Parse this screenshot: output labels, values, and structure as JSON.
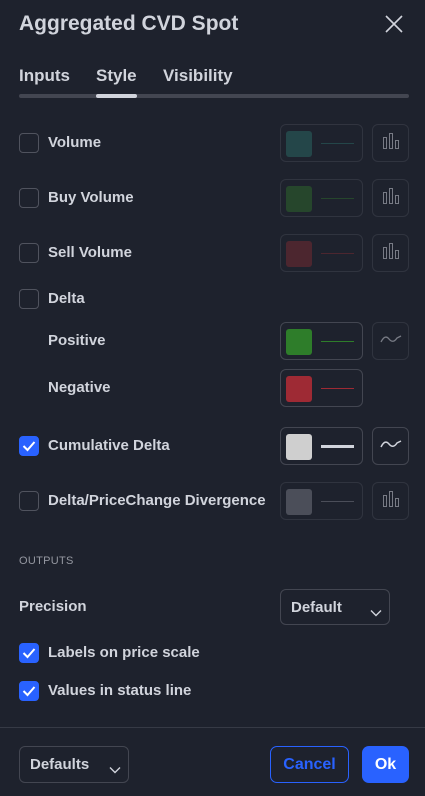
{
  "dialog": {
    "title": "Aggregated CVD Spot",
    "close_icon": "close-icon"
  },
  "tabs": [
    {
      "label": "Inputs",
      "active": false
    },
    {
      "label": "Style",
      "active": true
    },
    {
      "label": "Visibility",
      "active": false
    }
  ],
  "style_rows": [
    {
      "label": "Volume",
      "checked": false,
      "color": "#2a6b66",
      "line_color": "#2a6b66",
      "plot_icon": "histogram-icon",
      "disabled": true
    },
    {
      "label": "Buy Volume",
      "checked": false,
      "color": "#2f6b2c",
      "line_color": "#2f6b2c",
      "plot_icon": "histogram-icon",
      "disabled": true
    },
    {
      "label": "Sell Volume",
      "checked": false,
      "color": "#7a2b32",
      "line_color": "#7a2b32",
      "plot_icon": "histogram-icon",
      "disabled": true
    },
    {
      "label": "Delta",
      "checked": false
    },
    {
      "label": "Positive",
      "color": "#2e7d2a",
      "line_color": "#2e7d2a",
      "plot_icon": "line-wave-icon",
      "disabled": false
    },
    {
      "label": "Negative",
      "color": "#9e2a34",
      "line_color": "#9e2a34",
      "disabled": false
    },
    {
      "label": "Cumulative Delta",
      "checked": true,
      "color": "#cfcfcf",
      "line_color": "#d1d4dc",
      "plot_icon": "line-wave-icon",
      "disabled": false
    },
    {
      "label": "Delta/PriceChange Divergence",
      "checked": false,
      "color": "#787b86",
      "line_color": "#787b86",
      "plot_icon": "histogram-icon",
      "disabled": true
    }
  ],
  "outputs": {
    "section_title": "OUTPUTS",
    "precision_label": "Precision",
    "precision_value": "Default",
    "labels_on_price_scale": {
      "label": "Labels on price scale",
      "checked": true
    },
    "values_in_status_line": {
      "label": "Values in status line",
      "checked": true
    }
  },
  "footer": {
    "defaults_label": "Defaults",
    "cancel_label": "Cancel",
    "ok_label": "Ok"
  },
  "colors": {
    "background": "#1e222d",
    "accent": "#2962ff",
    "border": "#434651",
    "text": "#d1d4dc"
  }
}
